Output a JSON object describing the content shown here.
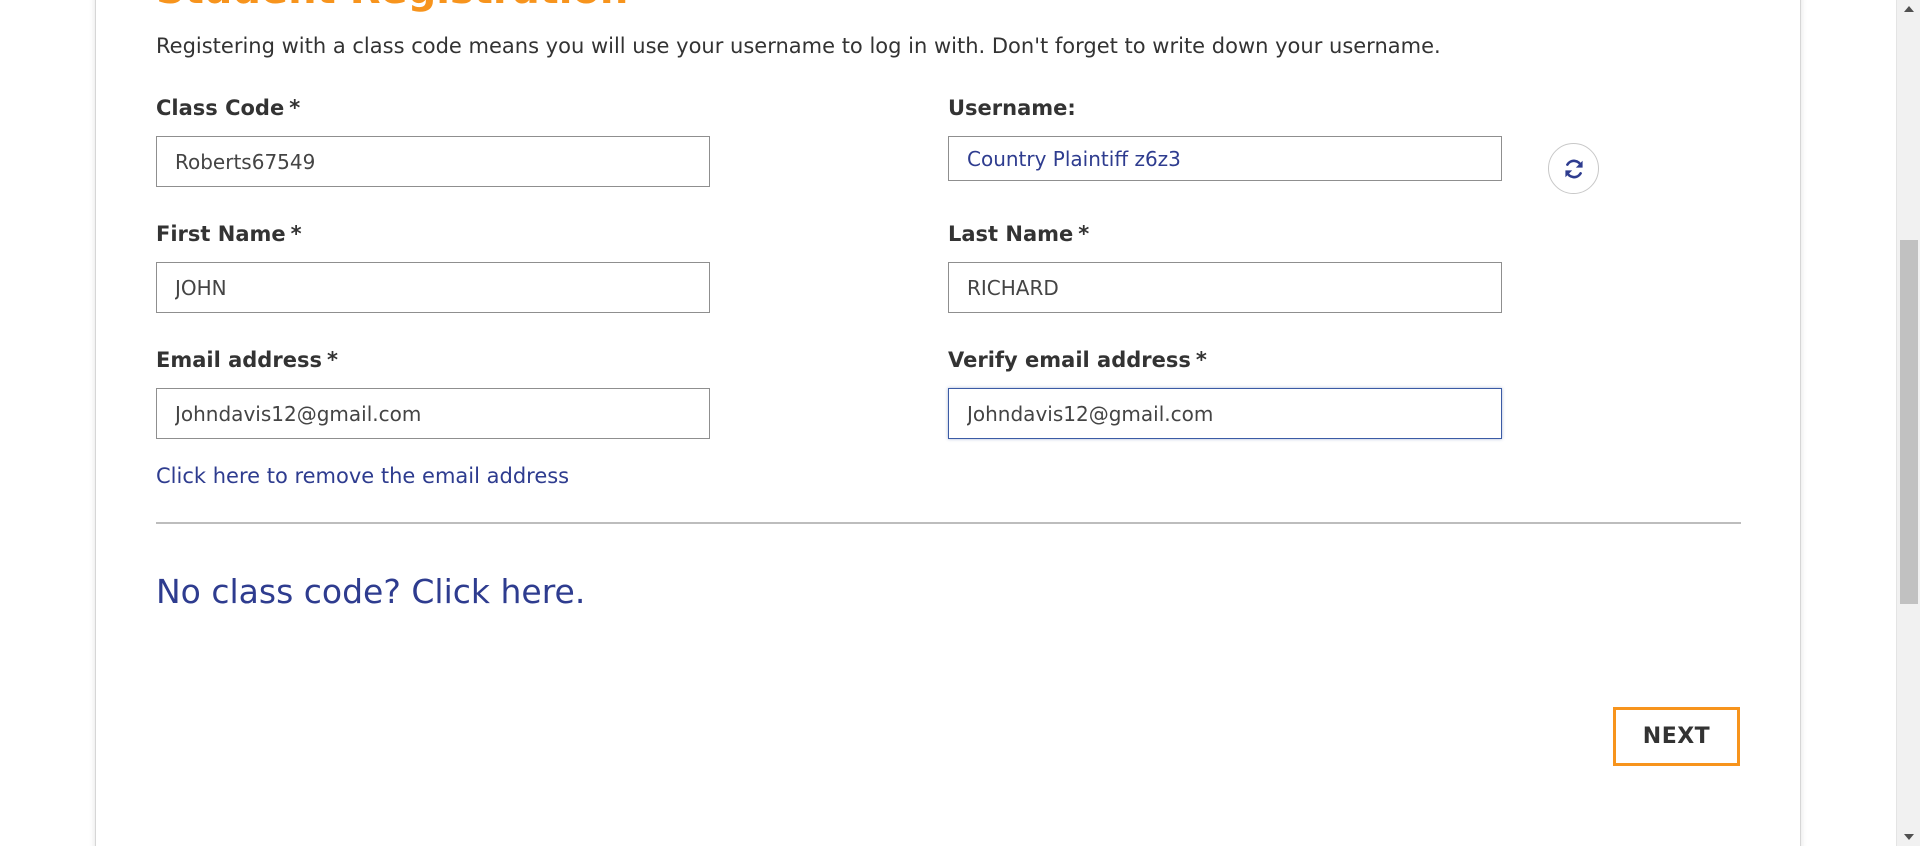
{
  "form": {
    "title": "Student Registration",
    "intro": "Registering with a class code means you will use your username to log in with. Don't forget to write down your username.",
    "required_mark": "*",
    "fields": {
      "class_code": {
        "label": "Class Code",
        "value": "Roberts67549"
      },
      "username": {
        "label": "Username:",
        "value": "Country Plaintiff z6z3"
      },
      "first_name": {
        "label": "First Name",
        "value": "JOHN"
      },
      "last_name": {
        "label": "Last Name",
        "value": "RICHARD"
      },
      "email": {
        "label": "Email address",
        "value": "Johndavis12@gmail.com"
      },
      "verify_email": {
        "label": "Verify email address",
        "value": "Johndavis12@gmail.com"
      }
    },
    "remove_email_link": "Click here to remove the email address",
    "no_class_code_link": "No class code? Click here.",
    "next_button": "NEXT",
    "refresh_icon": "refresh-icon"
  },
  "colors": {
    "accent_orange": "#f7941d",
    "link_blue": "#2e3c8f",
    "text": "#333333",
    "input_border": "#8f8f8f",
    "focus_border": "#3b5ba5"
  }
}
